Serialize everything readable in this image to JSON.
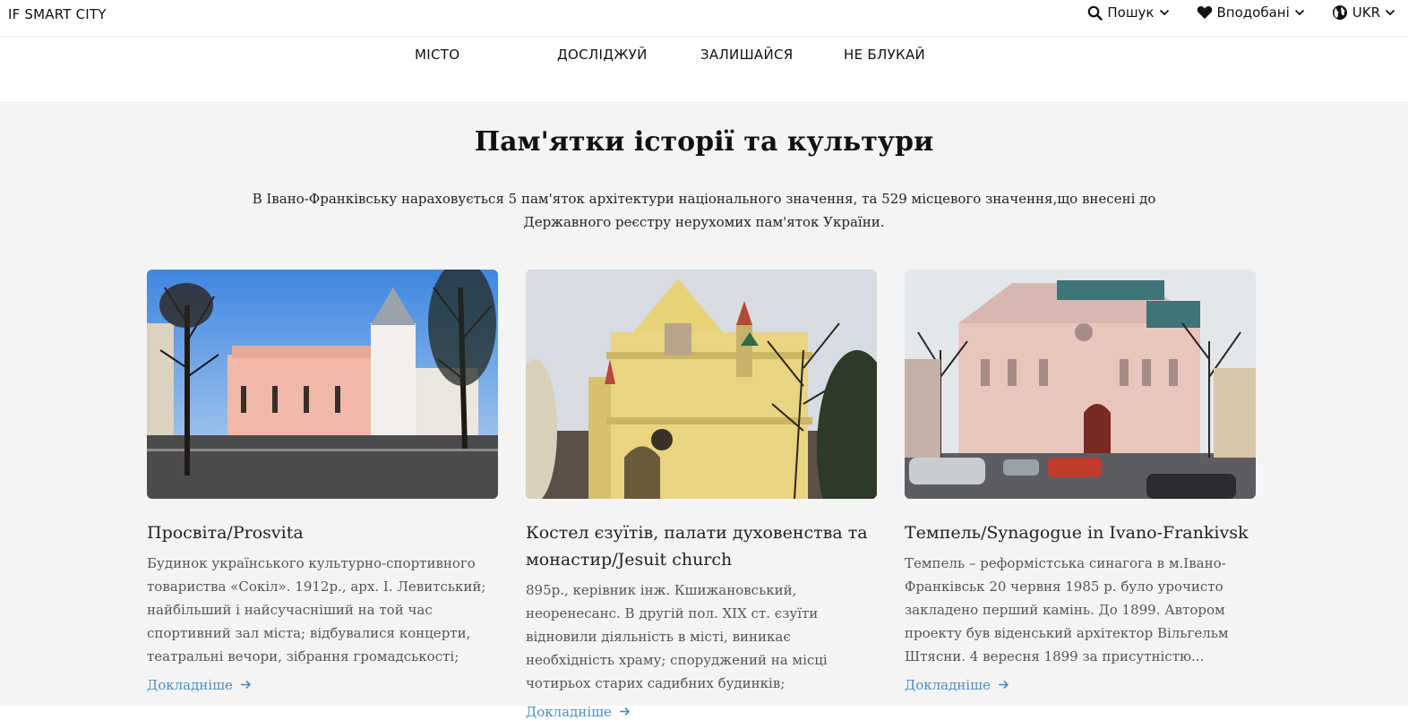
{
  "header": {
    "brand": "IF SMART CITY",
    "search_label": "Пошук",
    "favorites_label": "Вподобані",
    "language_label": "UKR"
  },
  "nav": {
    "items": [
      {
        "label": "МІСТО"
      },
      {
        "label": "ДОСЛІДЖУЙ"
      },
      {
        "label": "ЗАЛИШАЙСЯ"
      },
      {
        "label": "НЕ БЛУКАЙ"
      }
    ]
  },
  "section": {
    "title": "Пам'ятки історії та культури",
    "description": "В Івано-Франківську нараховується 5 пам'яток архітектури національного значення, та 529 місцевого значення,що внесені до Державного реєстру нерухомих пам'яток України."
  },
  "cards": [
    {
      "title": "Просвіта/Prosvita",
      "text": "Будинок українського культурно-спортивного товариства «Сокіл». 1912р., арх. І. Левитський; найбільший і найсучасніший на той час спортивний зал міста; відбувалися концерти, театральні вечори, зібрання громадськості;",
      "link": "Докладніше"
    },
    {
      "title": "Костел єзуїтів, палати духовенства та монастир/Jesuit church",
      "text": "895р., керівник інж. Кшижановський, неоренесанс. В другій пол. XIX ст. єзуїти відновили діяльність в місті, виникає необхідність храму; споруджений на місці чотирьох старих садибних будинків;",
      "link": "Докладніше"
    },
    {
      "title": "Темпель/Synagogue in Ivano-Frankivsk",
      "text": "Темпель – реформістська синагога в м.Івано-Франківськ 20 червня 1985 р. було урочисто закладено перший камінь. До 1899. Автором проекту був віденський архітектор Вільгельм Штясни. 4 вересня 1899 за присутністю...",
      "link": "Докладніше"
    }
  ],
  "colors": {
    "link": "#4a90c8",
    "content_bg": "#f3f4f3"
  }
}
